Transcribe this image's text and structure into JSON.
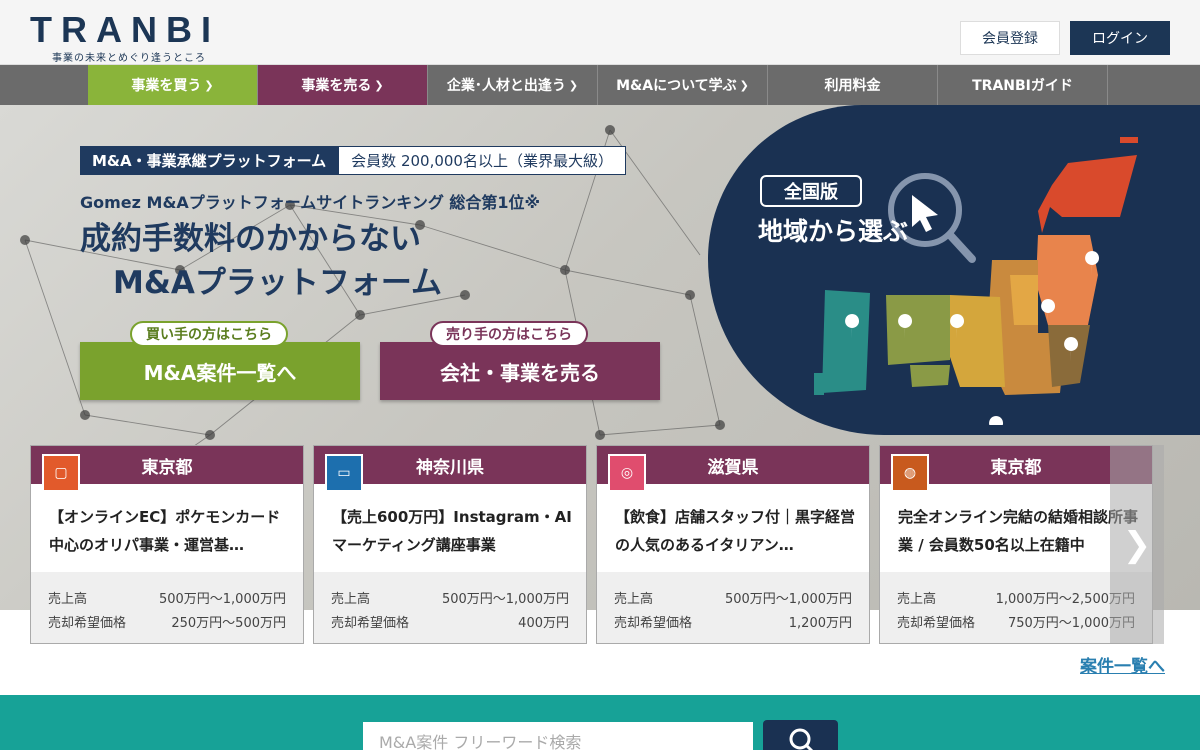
{
  "header": {
    "logo_text": "TRANBI",
    "tagline": "事業の未来とめぐり逢うところ",
    "register_label": "会員登録",
    "login_label": "ログイン"
  },
  "nav": {
    "items": [
      {
        "label": "事業を買う",
        "chevron": true,
        "color": "#8ab43a"
      },
      {
        "label": "事業を売る",
        "chevron": true,
        "color": "#7a3459"
      },
      {
        "label": "企業･人材と出逢う",
        "chevron": true,
        "color": "#6b6b6b"
      },
      {
        "label": "M&Aについて学ぶ",
        "chevron": true,
        "color": "#6b6b6b"
      },
      {
        "label": "利用料金",
        "chevron": false,
        "color": "#6b6b6b"
      },
      {
        "label": "TRANBIガイド",
        "chevron": false,
        "color": "#6b6b6b"
      }
    ]
  },
  "hero": {
    "badge_primary": "M&A・事業承継プラットフォーム",
    "badge_secondary": "会員数 200,000名以上（業界最大級）",
    "ranking": "Gomez M&Aプラットフォームサイトランキング 総合第1位※",
    "headline_line1": "成約手数料のかからない",
    "headline_line2": "M&Aプラットフォーム",
    "buyer_tag": "買い手の方はこちら",
    "buyer_cta": "M&A案件一覧へ",
    "seller_tag": "売り手の方はこちら",
    "seller_cta": "会社・事業を売る",
    "map_badge": "全国版",
    "map_title": "地域から選ぶ"
  },
  "listings": [
    {
      "prefecture": "東京都",
      "icon": "shopping-bag-icon",
      "icon_color": "#e25a2b",
      "title": "【オンラインEC】ポケモンカード中心のオリパ事業・運営基…",
      "sales_label": "売上高",
      "sales": "500万円〜1,000万円",
      "price_label": "売却希望価格",
      "price": "250万円〜500万円"
    },
    {
      "prefecture": "神奈川県",
      "icon": "monitor-icon",
      "icon_color": "#1d6fae",
      "title": "【売上600万円】Instagram・AIマーケティング講座事業",
      "sales_label": "売上高",
      "sales": "500万円〜1,000万円",
      "price_label": "売却希望価格",
      "price": "400万円"
    },
    {
      "prefecture": "滋賀県",
      "icon": "dining-icon",
      "icon_color": "#e04d6e",
      "title": "【飲食】店舗スタッフ付｜黒字経営の人気のあるイタリアン…",
      "sales_label": "売上高",
      "sales": "500万円〜1,000万円",
      "price_label": "売却希望価格",
      "price": "1,200万円"
    },
    {
      "prefecture": "東京都",
      "icon": "tennis-icon",
      "icon_color": "#c85a1e",
      "title": "完全オンライン完結の結婚相談所事業 / 会員数50名以上在籍中",
      "sales_label": "売上高",
      "sales": "1,000万円〜2,500万円",
      "price_label": "売却希望価格",
      "price": "750万円〜1,000万円"
    }
  ],
  "more_link": "案件一覧へ",
  "search": {
    "placeholder": "M&A案件 フリーワード検索"
  }
}
